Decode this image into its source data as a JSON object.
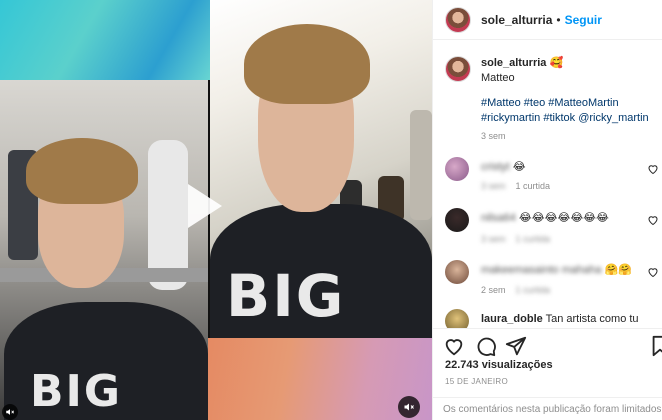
{
  "header": {
    "username": "sole_alturria",
    "separator": "•",
    "follow_label": "Seguir"
  },
  "caption": {
    "username": "sole_alturria",
    "emoji": "🥰",
    "text": "Matteo",
    "hashtags_line1": "#Matteo #teo #MatteoMartin",
    "hashtags_line2": "#rickymartin #tiktok @ricky_martin",
    "time": "3 sem"
  },
  "comments": [
    {
      "text": "cristyt",
      "emoji": "😂",
      "time": "3 sem",
      "likes": "1 curtida"
    },
    {
      "text": "nilsa64",
      "emoji": "😂😂😂😂😂😂😂",
      "time": "3 sem",
      "likes": "1 curtida"
    },
    {
      "text": "makeemasainto mahaha",
      "emoji": "🤗🤗",
      "time": "2 sem",
      "likes": "1 curtida"
    },
    {
      "user": "laura_doble",
      "text": "Tan artista como tu"
    }
  ],
  "media": {
    "shirt_text_left": "BIG",
    "shirt_text_right": "BIG"
  },
  "footer": {
    "views": "22.743 visualizações",
    "date": "15 DE JANEIRO",
    "comments_limited": "Os comentários nesta publicação foram limitados"
  },
  "icons": {
    "like": "heart-icon",
    "comment": "comment-icon",
    "share": "share-icon",
    "save": "bookmark-icon",
    "mute": "mute-icon",
    "play": "play-icon"
  },
  "colors": {
    "link_blue": "#0095f6",
    "hashtag": "#00376b",
    "meta_gray": "#8e8e8e"
  }
}
